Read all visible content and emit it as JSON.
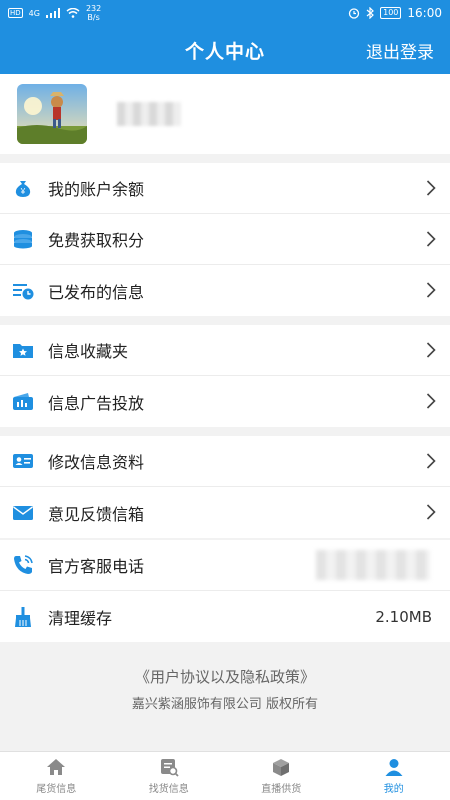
{
  "status": {
    "network_left": "HD",
    "signal": "4G",
    "net_speed": "232",
    "net_unit": "B/s",
    "battery": "100",
    "time": "16:00"
  },
  "header": {
    "title": "个人中心",
    "logout_label": "退出登录"
  },
  "menu": {
    "group1": [
      {
        "label": "我的账户余额",
        "icon": "money-bag-icon"
      },
      {
        "label": "免费获取积分",
        "icon": "coins-icon"
      },
      {
        "label": "已发布的信息",
        "icon": "published-list-icon"
      }
    ],
    "group2": [
      {
        "label": "信息收藏夹",
        "icon": "star-folder-icon"
      },
      {
        "label": "信息广告投放",
        "icon": "wallet-icon"
      }
    ],
    "group3": [
      {
        "label": "修改信息资料",
        "icon": "id-card-icon"
      },
      {
        "label": "意见反馈信箱",
        "icon": "mail-icon"
      }
    ],
    "group4": [
      {
        "label": "官方客服电话",
        "icon": "phone-icon"
      },
      {
        "label": "清理缓存",
        "icon": "broom-icon",
        "value": "2.10MB"
      }
    ]
  },
  "footer": {
    "policy_link": "《用户协议以及隐私政策》",
    "copyright": "嘉兴紫涵服饰有限公司 版权所有"
  },
  "tabs": [
    {
      "label": "尾货信息",
      "icon": "home-icon",
      "active": false
    },
    {
      "label": "找货信息",
      "icon": "search-list-icon",
      "active": false
    },
    {
      "label": "直播供货",
      "icon": "box-icon",
      "active": false
    },
    {
      "label": "我的",
      "icon": "user-icon",
      "active": true
    }
  ],
  "colors": {
    "primary": "#1f8fe0",
    "background": "#f2f2f2"
  }
}
